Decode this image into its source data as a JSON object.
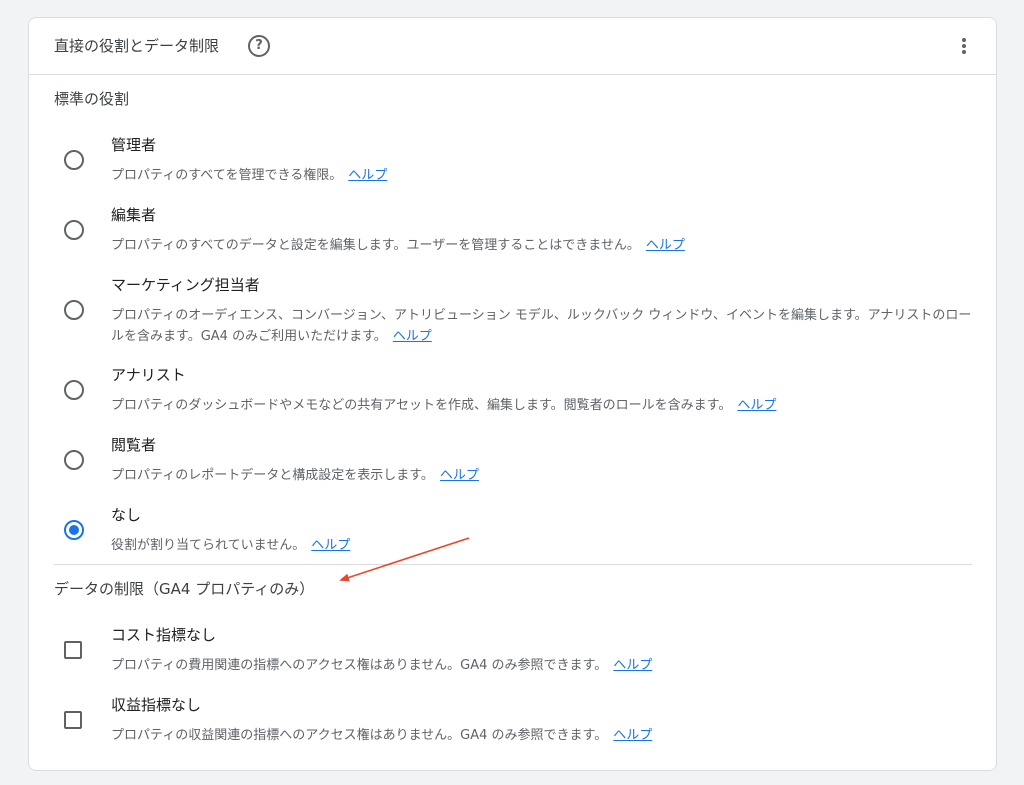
{
  "card": {
    "title": "直接の役割とデータ制限",
    "help_icon": "help-circle-icon",
    "more_icon": "more-vert-icon"
  },
  "standard_roles": {
    "title": "標準の役割",
    "help_label": "ヘルプ",
    "items": [
      {
        "label": "管理者",
        "description": "プロパティのすべてを管理できる権限。",
        "selected": false
      },
      {
        "label": "編集者",
        "description": "プロパティのすべてのデータと設定を編集します。ユーザーを管理することはできません。",
        "selected": false
      },
      {
        "label": "マーケティング担当者",
        "description": "プロパティのオーディエンス、コンバージョン、アトリビューション モデル、ルックバック ウィンドウ、イベントを編集します。アナリストのロールを含みます。GA4 のみご利用いただけます。",
        "selected": false
      },
      {
        "label": "アナリスト",
        "description": "プロパティのダッシュボードやメモなどの共有アセットを作成、編集します。閲覧者のロールを含みます。",
        "selected": false
      },
      {
        "label": "閲覧者",
        "description": "プロパティのレポートデータと構成設定を表示します。",
        "selected": false
      },
      {
        "label": "なし",
        "description": "役割が割り当てられていません。",
        "selected": true
      }
    ]
  },
  "data_restrictions": {
    "title": "データの制限（GA4 プロパティのみ）",
    "help_label": "ヘルプ",
    "items": [
      {
        "label": "コスト指標なし",
        "description": "プロパティの費用関連の指標へのアクセス権はありません。GA4 のみ参照できます。",
        "checked": false
      },
      {
        "label": "収益指標なし",
        "description": "プロパティの収益関連の指標へのアクセス権はありません。GA4 のみ参照できます。",
        "checked": false
      }
    ]
  },
  "colors": {
    "accent": "#1a73e8",
    "annotation_arrow": "#e8472d"
  }
}
